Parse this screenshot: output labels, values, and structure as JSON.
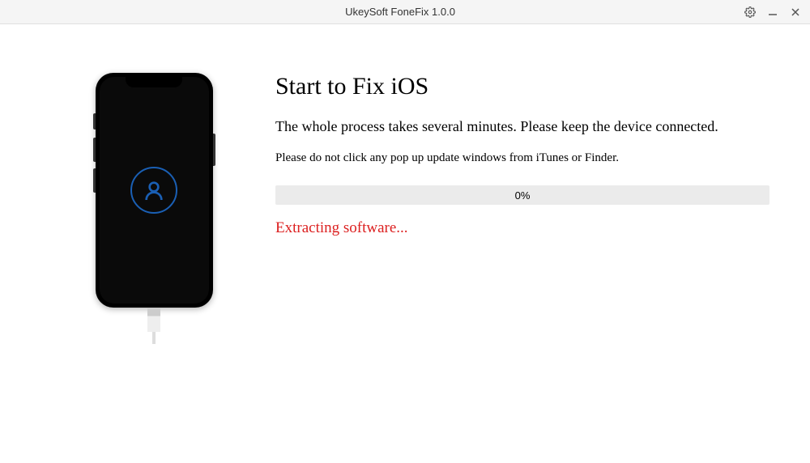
{
  "titlebar": {
    "title": "UkeySoft FoneFix 1.0.0"
  },
  "main": {
    "heading": "Start to Fix iOS",
    "subtitle": "The whole process takes several minutes. Please keep the device connected.",
    "warning": "Please do not click any pop up update windows from iTunes or Finder.",
    "progress_percent": "0%",
    "status": "Extracting software..."
  }
}
